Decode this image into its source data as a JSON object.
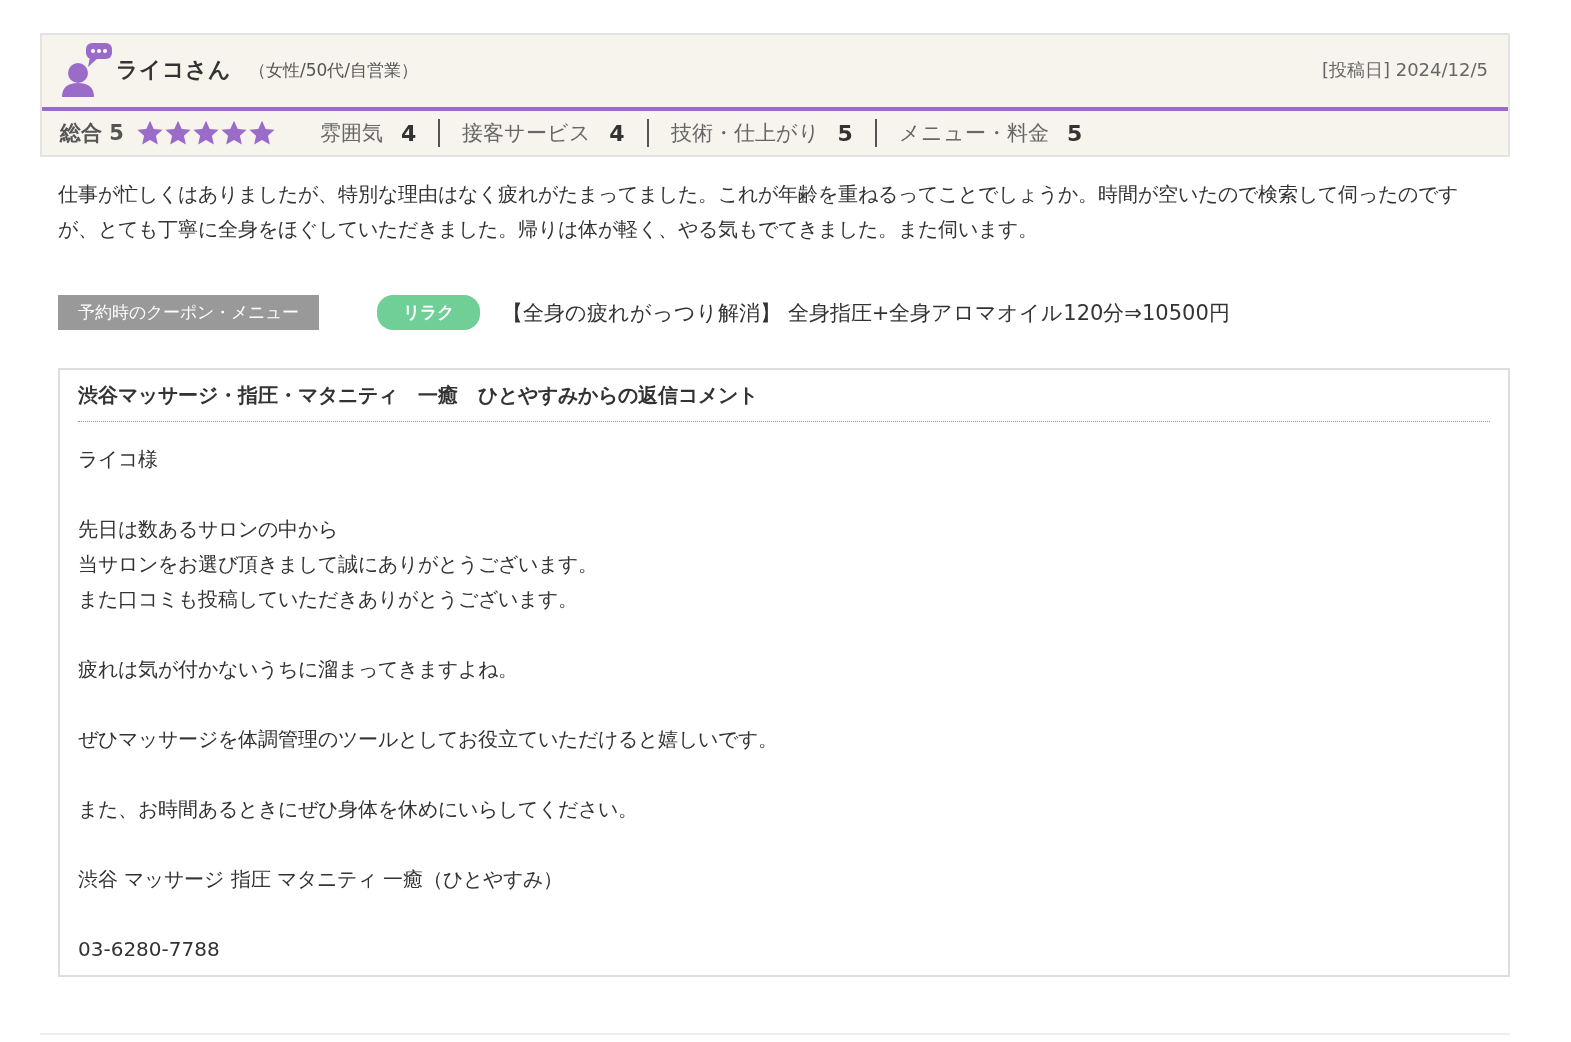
{
  "review": {
    "reviewer": "ライコさん",
    "profile": "（女性/50代/自営業）",
    "posted": "[投稿日] 2024/12/5",
    "overall_label": "総合",
    "overall_score": "5",
    "stars": 5,
    "ratings": [
      {
        "label": "雰囲気",
        "score": "4"
      },
      {
        "label": "接客サービス",
        "score": "4"
      },
      {
        "label": "技術・仕上がり",
        "score": "5"
      },
      {
        "label": "メニュー・料金",
        "score": "5"
      }
    ],
    "body": "仕事が忙しくはありましたが、特別な理由はなく疲れがたまってました。これが年齢を重ねるってことでしょうか。時間が空いたので検索して伺ったのですが、とても丁寧に全身をほぐしていただきました。帰りは体が軽く、やる気もでてきました。また伺います。",
    "coupon_label": "予約時のクーポン・メニュー",
    "coupon_tag": "リラク",
    "coupon_text": "【全身の疲れがっつり解消】 全身指圧+全身アロマオイル120分⇒10500円"
  },
  "reply": {
    "title": "渋谷マッサージ・指圧・マタニティ　一癒　ひとやすみからの返信コメント",
    "paragraphs": [
      [
        "ライコ様"
      ],
      [
        "先日は数あるサロンの中から",
        "当サロンをお選び頂きまして誠にありがとうございます。",
        "また口コミも投稿していただきありがとうございます。"
      ],
      [
        "疲れは気が付かないうちに溜まってきますよね。"
      ],
      [
        "ぜひマッサージを体調管理のツールとしてお役立ていただけると嬉しいです。"
      ],
      [
        "また、お時間あるときにぜひ身体を休めにいらしてください。"
      ],
      [
        "渋谷 マッサージ 指圧 マタニティ 一癒（ひとやすみ）"
      ],
      [
        "03-6280-7788"
      ]
    ]
  }
}
